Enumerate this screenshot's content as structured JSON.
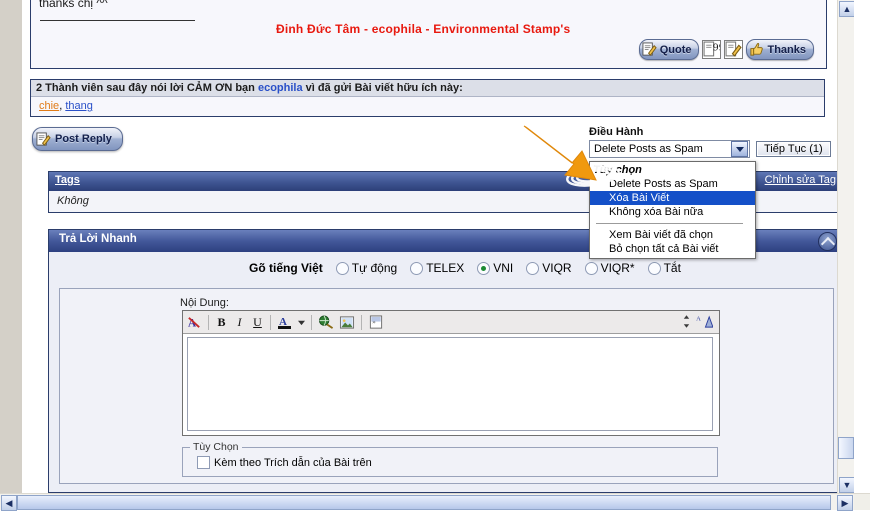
{
  "post": {
    "body_text": "thanks chị ^^",
    "signature": "Đinh Đức Tâm - ecophila - Environmental Stamp's",
    "buttons": [
      {
        "name": "quote",
        "label": "Quote"
      },
      {
        "name": "multiquote",
        "label": ""
      },
      {
        "name": "edit",
        "label": ""
      },
      {
        "name": "thanks",
        "label": "Thanks"
      }
    ]
  },
  "thanks": {
    "headline_prefix": "2 Thành viên sau đây nói lời CẢM ƠN bạn ",
    "headline_user": "ecophila",
    "headline_suffix": " vì đã gửi Bài viết hữu ích này:",
    "users": [
      {
        "name": "chie",
        "color": "#e07b18"
      },
      {
        "name": "thang",
        "color": "#2a50c8"
      }
    ],
    "users_separator": ", "
  },
  "actions": {
    "post_reply_label": "Post Reply"
  },
  "tags": {
    "header_label": "Tags",
    "edit_link": "Chỉnh sửa Tag",
    "value": "Không"
  },
  "moderation": {
    "label": "Điều Hành",
    "selected_value": "Delete Posts as Spam",
    "continue_button": "Tiếp Tục (1)",
    "menu": {
      "group_label": "Tùy chọn",
      "items": [
        {
          "label": "Delete Posts as Spam",
          "selected": false
        },
        {
          "label": "Xóa Bài Viết",
          "selected": true
        },
        {
          "label": "Không xóa Bài nữa",
          "selected": false
        }
      ],
      "items2": [
        {
          "label": "Xem Bài viết đã chọn",
          "selected": false
        },
        {
          "label": "Bỏ chọn tất cả Bài viết",
          "selected": false
        }
      ]
    }
  },
  "quick_reply": {
    "title": "Trả Lời Nhanh",
    "input_method_label": "Gõ tiếng Việt",
    "input_methods": [
      {
        "label": "Tự động",
        "selected": false
      },
      {
        "label": "TELEX",
        "selected": false
      },
      {
        "label": "VNI",
        "selected": true
      },
      {
        "label": "VIQR",
        "selected": false
      },
      {
        "label": "VIQR*",
        "selected": false
      },
      {
        "label": "Tắt",
        "selected": false
      }
    ],
    "content_label": "Nội Dung:",
    "editor_value": "",
    "toolbar": [
      {
        "name": "remove-format-icon",
        "glyph": "A"
      },
      {
        "name": "bold-icon",
        "glyph": "B"
      },
      {
        "name": "italic-icon",
        "glyph": "I"
      },
      {
        "name": "underline-icon",
        "glyph": "U"
      },
      {
        "name": "font-color-icon",
        "glyph": "A"
      },
      {
        "name": "insert-link-icon",
        "glyph": ""
      },
      {
        "name": "insert-image-icon",
        "glyph": ""
      },
      {
        "name": "insert-quote-icon",
        "glyph": ""
      }
    ],
    "options_legend": "Tùy Chọn",
    "quote_checkbox_label": "Kèm theo Trích dẫn của Bài trên",
    "quote_checkbox_checked": false
  },
  "colors": {
    "accent_blue": "#2c3f78",
    "signature_red": "#e8190f",
    "highlight_blue": "#1450c8",
    "arrow_orange": "#f0990f"
  }
}
